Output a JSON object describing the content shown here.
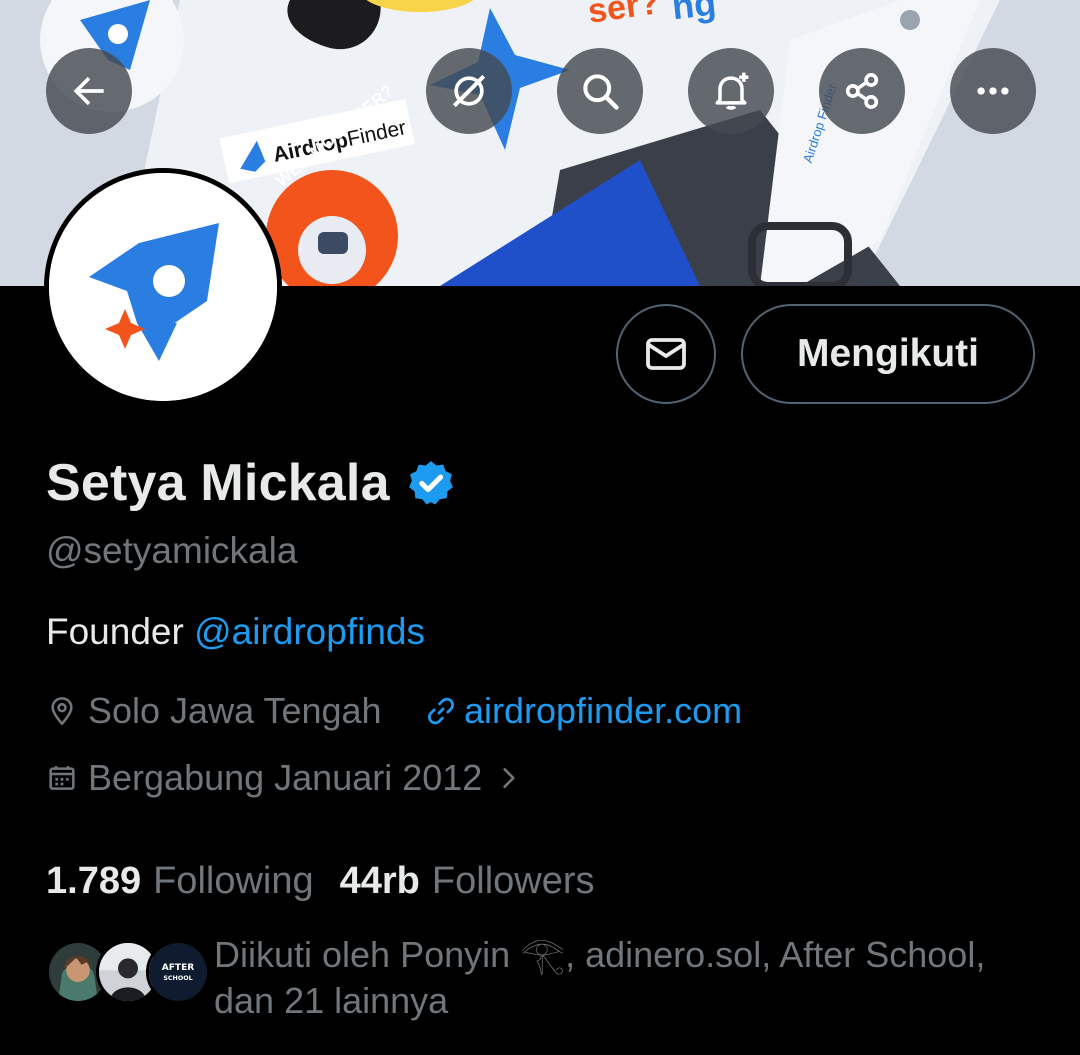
{
  "profile": {
    "name": "Setya Mickala",
    "handle": "@setyamickala",
    "bio_prefix": "Founder ",
    "bio_mention": "@airdropfinds",
    "location": "Solo Jawa Tengah",
    "website": "airdropfinder.com",
    "joined": "Bergabung Januari 2012",
    "following_count": "1.789",
    "following_label": "Following",
    "followers_count": "44rb",
    "followers_label": "Followers",
    "followed_by_text": "Diikuti oleh Ponyin 𓂀, adinero.sol, After School, dan 21 lainnya"
  },
  "banner": {
    "sticker_brand": "Airdrop",
    "sticker_brand_suffix": "Finder",
    "sticker_moon": "WEN MOON SER?",
    "top_text_a": "ser?",
    "top_text_b": "ng",
    "watch_band_text": "Airdrop Finder"
  },
  "actions": {
    "follow_label": "Mengikuti"
  },
  "followed_avatars": [
    {
      "name": "Ponyin"
    },
    {
      "name": "adinero.sol"
    },
    {
      "name": "After School",
      "text": "AFTER SCHOOL"
    }
  ],
  "icons": {
    "back": "back-arrow-icon",
    "grok": "grok-icon",
    "search": "search-icon",
    "notify": "bell-plus-icon",
    "share": "share-icon",
    "more": "more-icon",
    "message": "envelope-icon",
    "verified": "verified-badge-icon",
    "location": "location-pin-icon",
    "link": "link-icon",
    "calendar": "calendar-icon"
  },
  "colors": {
    "accent": "#1d9bf0",
    "secondary_text": "#71767b",
    "primary_text": "#e7e9ea",
    "brand_blue": "#2a7de1",
    "brand_orange": "#f2541b"
  }
}
